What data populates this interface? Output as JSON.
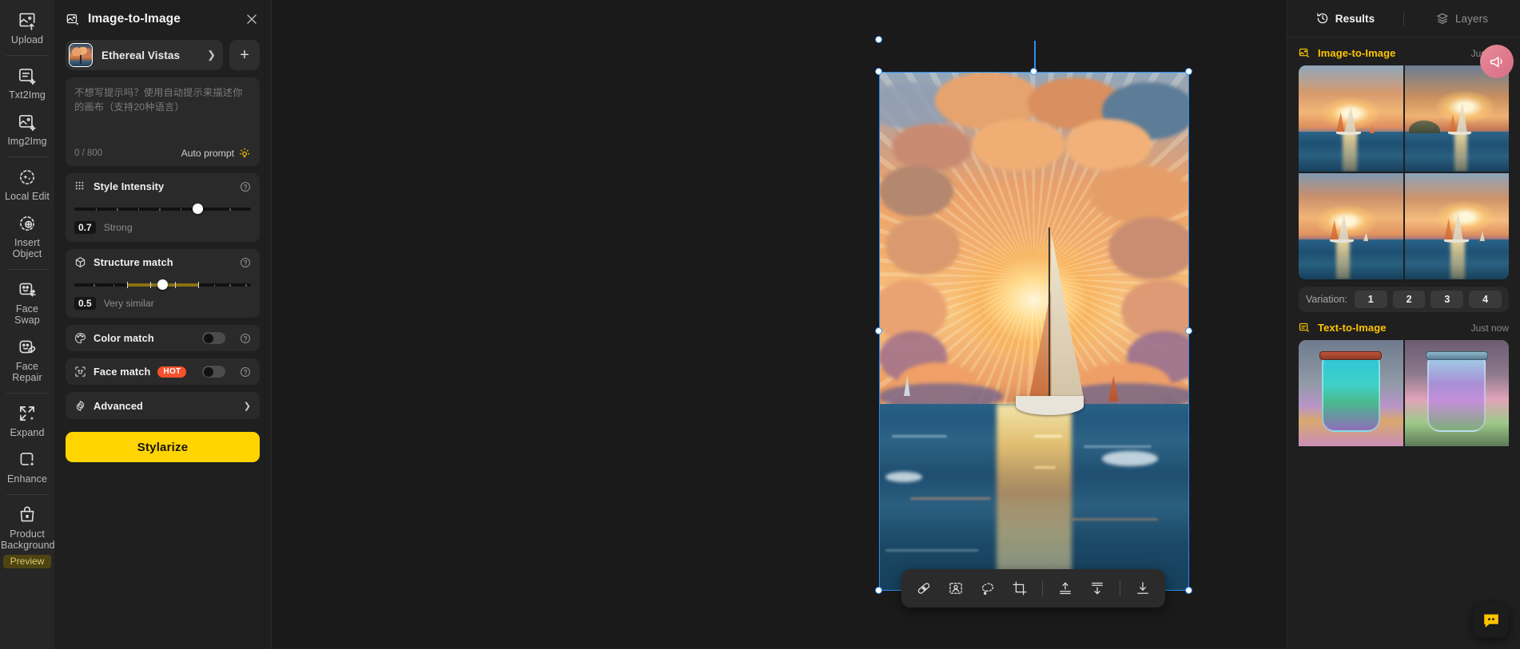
{
  "rail": {
    "groups": [
      {
        "items": [
          {
            "label": "Upload",
            "icon": "upload-image-icon"
          }
        ]
      },
      {
        "items": [
          {
            "label": "Txt2Img",
            "icon": "text-to-image-icon"
          },
          {
            "label": "Img2Img",
            "icon": "image-to-image-icon"
          }
        ]
      },
      {
        "items": [
          {
            "label": "Local Edit",
            "icon": "local-edit-sparkle-icon"
          },
          {
            "label": "Insert\nObject",
            "icon": "insert-object-icon"
          }
        ]
      },
      {
        "items": [
          {
            "label": "Face\nSwap",
            "icon": "face-swap-icon"
          },
          {
            "label": "Face\nRepair",
            "icon": "face-repair-icon"
          }
        ]
      },
      {
        "items": [
          {
            "label": "Expand",
            "icon": "expand-arrows-icon"
          },
          {
            "label": "Enhance",
            "icon": "enhance-sparkle-icon"
          }
        ]
      },
      {
        "items": [
          {
            "label": "Product\nBackground",
            "icon": "product-bag-icon",
            "badge": "Preview"
          }
        ]
      }
    ]
  },
  "panel": {
    "icon": "image-to-image-icon",
    "title": "Image-to-Image",
    "close_icon": "close-icon",
    "style": {
      "name": "Ethereal Vistas",
      "chevron": "chevron-right-icon",
      "add_label": "+"
    },
    "prompt": {
      "placeholder": "不想写提示吗？使用自动提示来描述你的画布（支持20种语言）",
      "value": "",
      "counter": "0 / 800",
      "auto_prompt_label": "Auto prompt",
      "auto_prompt_icon": "lightbulb-icon"
    },
    "style_intensity": {
      "icon": "dots-grid-icon",
      "label": "Style Intensity",
      "help_icon": "help-circle-icon",
      "value": "0.7",
      "value_label": "Strong",
      "percent": 70
    },
    "structure_match": {
      "icon": "cube-icon",
      "label": "Structure match",
      "help_icon": "help-circle-icon",
      "value": "0.5",
      "value_label": "Very similar",
      "percent": 50,
      "range_start": 30,
      "range_end": 70
    },
    "color_match": {
      "icon": "palette-icon",
      "label": "Color match",
      "help_icon": "help-circle-icon",
      "enabled": false
    },
    "face_match": {
      "icon": "face-smile-icon",
      "label": "Face match",
      "badge": "HOT",
      "help_icon": "help-circle-icon",
      "enabled": false
    },
    "advanced": {
      "icon": "gear-icon",
      "label": "Advanced",
      "chevron": "chevron-right-icon"
    },
    "cta_label": "Stylarize"
  },
  "canvas": {
    "toolbar": [
      {
        "name": "heal-brush-tool",
        "icon": "bandaid-icon"
      },
      {
        "name": "face-select-tool",
        "icon": "face-frame-icon"
      },
      {
        "name": "lasso-select-tool",
        "icon": "lasso-icon"
      },
      {
        "name": "crop-tool",
        "icon": "crop-icon"
      },
      {
        "name": "separator-1",
        "icon": "divider"
      },
      {
        "name": "bring-to-front",
        "icon": "bring-front-icon"
      },
      {
        "name": "send-to-back",
        "icon": "send-back-icon"
      },
      {
        "name": "separator-2",
        "icon": "divider"
      },
      {
        "name": "download-button",
        "icon": "download-icon"
      }
    ],
    "selection": {
      "handles": [
        "top-left",
        "top-center",
        "top-right",
        "middle-left",
        "middle-right",
        "bottom-left",
        "bottom-center",
        "bottom-right"
      ],
      "rotate_handle": "rotate-handle"
    }
  },
  "right": {
    "tabs": [
      {
        "label": "Results",
        "icon": "history-clock-icon",
        "active": true
      },
      {
        "label": "Layers",
        "icon": "layers-icon",
        "active": false
      }
    ],
    "sections": [
      {
        "title": "Image-to-Image",
        "icon": "image-to-image-icon",
        "time": "Just now",
        "variation_label": "Variation:",
        "variations": [
          "1",
          "2",
          "3",
          "4"
        ]
      },
      {
        "title": "Text-to-Image",
        "icon": "text-to-image-icon",
        "time": "Just now"
      }
    ],
    "chat_icon": "chat-bubble-icon",
    "notif_icon": "megaphone-icon"
  }
}
